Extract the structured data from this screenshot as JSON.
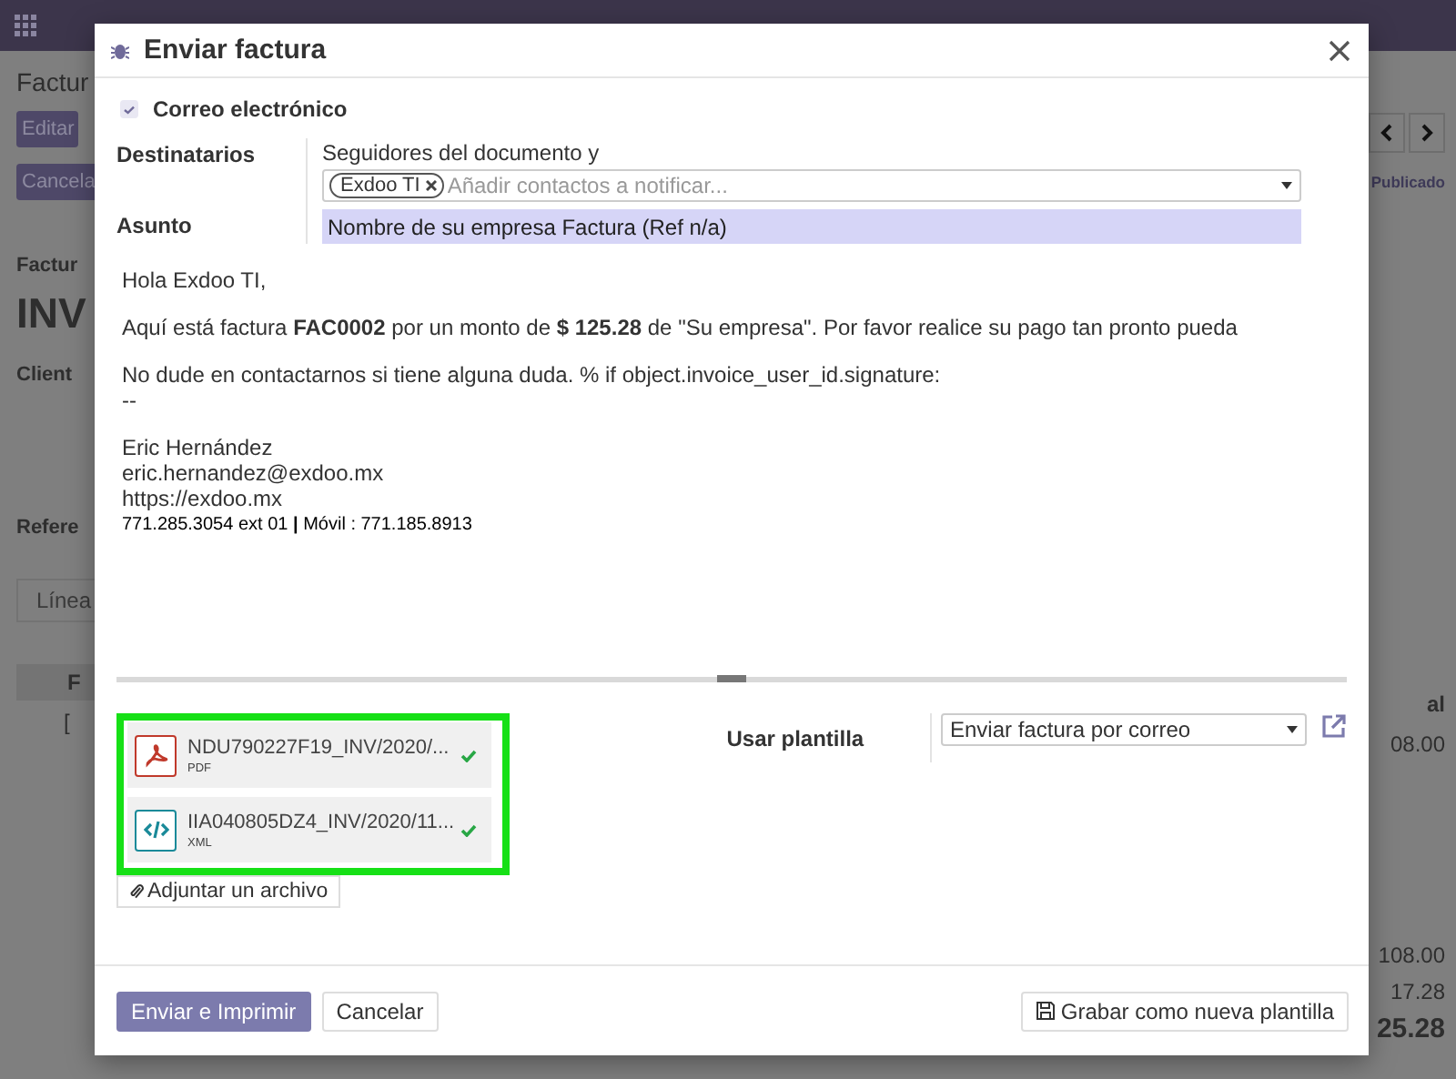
{
  "backdrop": {
    "breadcrumb": "Factur",
    "edit_button": "Editar",
    "cancel_button": "Cancela",
    "status": "Publicado",
    "sheet_label": "Factur",
    "sheet_title": "INV",
    "client_label": "Client",
    "reference_label": "Refere",
    "tab": "Línea",
    "table_header": "F",
    "table_cell": "[",
    "right_header": "al",
    "right_cell": "08.00",
    "untaxed": "108.00",
    "tax": "17.28",
    "total": "25.28"
  },
  "dialog": {
    "title": "Enviar factura",
    "email": {
      "label": "Correo electrónico",
      "checked": true
    },
    "recipients": {
      "label": "Destinatarios",
      "note": "Seguidores del documento y",
      "tags": [
        "Exdoo TI"
      ],
      "placeholder": "Añadir contactos a notificar..."
    },
    "subject": {
      "label": "Asunto",
      "value": "Nombre de su empresa Factura (Ref n/a)"
    },
    "body": [
      {
        "lines": [
          {
            "text": "Hola Exdoo TI,",
            "kind": "text"
          }
        ]
      },
      {
        "lines": [
          {
            "text": "Aquí está factura  **FAC0002** por un monto de **$ 125.28** de \"Su empresa\". Por favor realice su pago tan pronto pueda",
            "kind": "text"
          }
        ]
      },
      {
        "lines": [
          {
            "text": "No dude en contactarnos si tiene alguna duda. % if object.invoice_user_id.signature:",
            "kind": "text"
          },
          {
            "text": "--",
            "kind": "text"
          }
        ]
      },
      {
        "lines": [
          {
            "text": "Eric Hernández",
            "kind": "text"
          },
          {
            "text": "eric.hernandez@exdoo.mx",
            "kind": "text"
          },
          {
            "text": "https://exdoo.mx",
            "kind": "text"
          },
          {
            "text": "771.285.3054 ext 01 **|** Móvil : 771.185.8913",
            "kind": "small"
          }
        ]
      }
    ],
    "attachments": [
      {
        "name": "NDU790227F19_INV/2020/...",
        "type": "PDF",
        "kind": "pdf",
        "uploaded": true
      },
      {
        "name": "IIA040805DZ4_INV/2020/11...",
        "type": "XML",
        "kind": "xml",
        "uploaded": true
      }
    ],
    "attach_button": "Adjuntar un archivo",
    "template": {
      "label": "Usar plantilla",
      "value": "Enviar factura por correo"
    },
    "buttons": {
      "send": "Enviar e Imprimir",
      "cancel": "Cancelar",
      "save_template": "Grabar como nueva plantilla"
    }
  }
}
